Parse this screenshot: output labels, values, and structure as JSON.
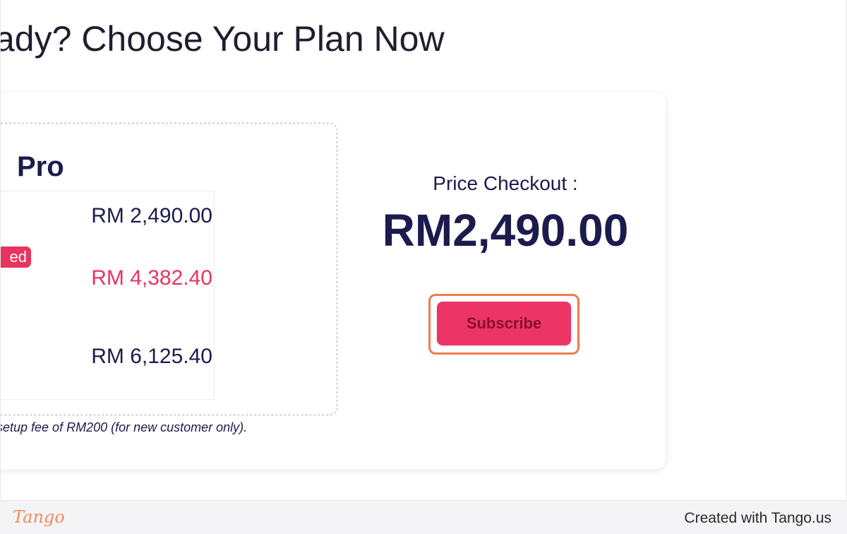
{
  "headline": "ady? Choose Your Plan Now",
  "plan": {
    "name": "Pro",
    "badge": "ed",
    "prices": [
      "RM 2,490.00",
      "RM 4,382.40",
      "RM 6,125.40"
    ],
    "setup_note": "setup fee of RM200 (for new customer only)."
  },
  "checkout": {
    "label": "Price Checkout :",
    "total": "RM2,490.00",
    "subscribe_label": "Subscribe"
  },
  "footer": {
    "logo": "Tango",
    "credit": "Created with Tango.us"
  },
  "colors": {
    "accent": "#ec3566",
    "text_dark": "#1b1b4d",
    "highlight": "#f27a4a"
  }
}
